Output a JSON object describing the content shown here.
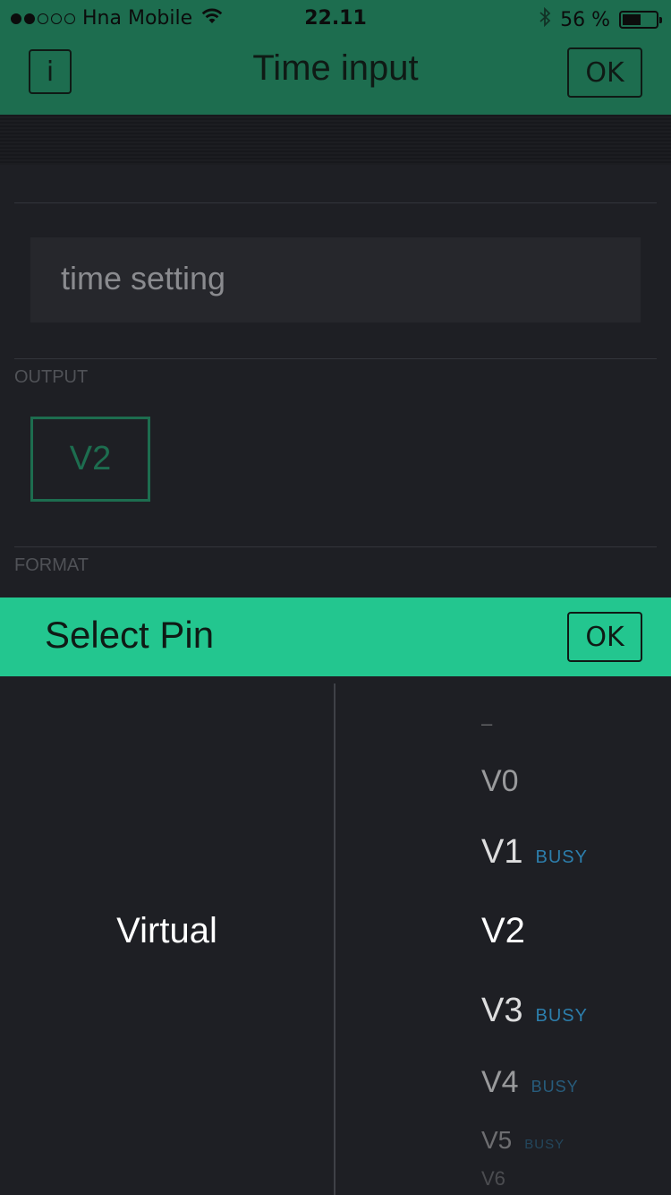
{
  "status_bar": {
    "carrier": "Hna Mobile",
    "time": "22.11",
    "battery_percent": "56 %",
    "battery_level": 0.56,
    "signal_bars_filled": 2,
    "signal_bars_total": 5
  },
  "header": {
    "info_label": "i",
    "title": "Time input",
    "ok_label": "OK"
  },
  "form": {
    "name_value": "time setting",
    "output_label": "OUTPUT",
    "output_pin": "V2",
    "format_label": "FORMAT"
  },
  "sheet": {
    "title": "Select Pin",
    "ok_label": "OK",
    "pin_type": "Virtual",
    "pins": [
      {
        "name": "–",
        "busy": ""
      },
      {
        "name": "V0",
        "busy": ""
      },
      {
        "name": "V1",
        "busy": "BUSY"
      },
      {
        "name": "V2",
        "busy": ""
      },
      {
        "name": "V3",
        "busy": "BUSY"
      },
      {
        "name": "V4",
        "busy": "BUSY"
      },
      {
        "name": "V5",
        "busy": "BUSY"
      },
      {
        "name": "V6",
        "busy": ""
      }
    ]
  },
  "colors": {
    "header_green": "#1d6d4f",
    "sheet_green": "#23c68f",
    "busy_blue": "#2f8fc4",
    "background": "#1e1f24"
  }
}
